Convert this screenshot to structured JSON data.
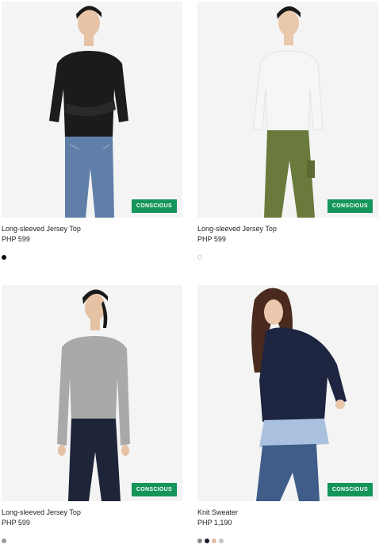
{
  "products": [
    {
      "title": "Long-sleeved Jersey Top",
      "price": "PHP 599",
      "badge": "CONSCIOUS",
      "swatches": [
        "#111111"
      ],
      "colors": {
        "top": "#1b1b1b",
        "bottom": "#5f7fa8",
        "skin": "#e8c3a6",
        "hair": "#1a1a1a"
      }
    },
    {
      "title": "Long-sleeved Jersey Top",
      "price": "PHP 599",
      "badge": "CONSCIOUS",
      "swatches": [
        "#ffffff"
      ],
      "colors": {
        "top": "#f6f6f6",
        "bottom": "#6a7a3c",
        "skin": "#e9c7aa",
        "hair": "#1a1a1a"
      }
    },
    {
      "title": "Long-sleeved Jersey Top",
      "price": "PHP 599",
      "badge": "CONSCIOUS",
      "swatches": [
        "#999999"
      ],
      "colors": {
        "top": "#a9a9a9",
        "bottom": "#1e2538",
        "skin": "#e6c2a4",
        "hair": "#1a1a1a"
      }
    },
    {
      "title": "Knit Sweater",
      "price": "PHP 1,190",
      "badge": "CONSCIOUS",
      "swatches": [
        "#8a8a8a",
        "#1b1b2b",
        "#e3b9a2",
        "#c4c4c4"
      ],
      "colors": {
        "top": "#1d2540",
        "bottom": "#3f5d88",
        "skin": "#ebc8ad",
        "hair": "#4a2a1e"
      }
    }
  ],
  "accent": "#15955a"
}
